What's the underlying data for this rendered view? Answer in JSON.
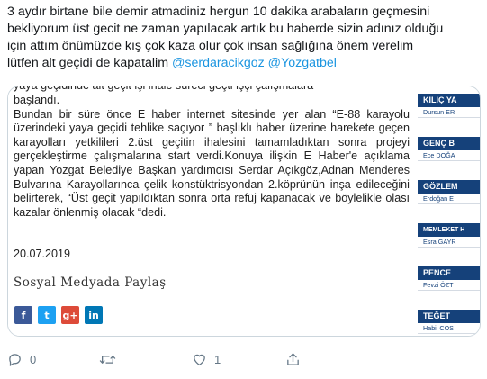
{
  "tweet": {
    "text_lines": [
      "3 aydır birtane bile demir atmadiniz hergun 10 dakika arabaların geçmesini",
      "bekliyorum üst gecit ne zaman yapılacak artık bu haberde sizin adınız olduğu",
      "için attım önümüzde kış çok kaza olur çok insan sağlığına önem verelim"
    ],
    "last_line_text": "lütfen alt geçidi de kapatalim ",
    "mention_1": "@serdaracikgoz",
    "mention_2": "@Yozgatbel"
  },
  "article": {
    "clipped_top": "başlandı.",
    "clipped_top_line": "yaya geçidinde alt geçit işi ihale süreci geçti işçi çalışmalara",
    "paragraph_1": "Bundan bir süre önce E haber internet sitesinde yer alan “E-88 karayolu üzerindeki yaya geçidi tehlike saçıyor ” başlıklı haber üzerine harekete geçen karayolları yetkilileri 2.üst geçitin ihalesini tamamladıktan sonra projeyi gerçekleştirme çalışmalarına start verdi.Konuya ilişkin E Haber'e açıklama yapan Yozgat Belediye Başkan yardımcısı Serdar Açıkgöz,Adnan Menderes Bulvarına Karayollarınca çelik konstüktrisyondan 2.köprünün inşa edileceğini belirterek, “Üst geçit yapıldıktan sonra orta refüj kapanacak ve böylelikle olası kazalar önlenmiş olacak “dedi.",
    "date": "20.07.2019",
    "share_title": "Sosyal Medyada Paylaş",
    "share_buttons": [
      {
        "icon": "facebook-icon",
        "glyph": "f",
        "color": "#3b5998"
      },
      {
        "icon": "twitter-icon",
        "glyph": "t",
        "color": "#1da1f2"
      },
      {
        "icon": "google-plus-icon",
        "glyph": "g+",
        "color": "#dd4b39"
      },
      {
        "icon": "linkedin-icon",
        "glyph": "in",
        "color": "#0077b5"
      }
    ]
  },
  "sidebar": {
    "blocks": [
      {
        "head": "KILIÇ YA",
        "name": "Dursun ER"
      },
      {
        "head": "GENÇ B",
        "name": "Ece DOĞA"
      },
      {
        "head": "GÖZLEM",
        "name": "Erdoğan E"
      },
      {
        "head": "MEMLEKET H",
        "name": "Esra GAYR"
      },
      {
        "head": "PENCE",
        "name": "Fevzi ÖZT"
      },
      {
        "head": "TEĞET",
        "name": "Habil COS"
      }
    ],
    "head_color": "#15417a"
  },
  "actions": {
    "reply_count": "0",
    "retweet_count": "",
    "like_count": "1"
  },
  "colors": {
    "mention": "#1b95e0",
    "action_gray": "#657786"
  }
}
